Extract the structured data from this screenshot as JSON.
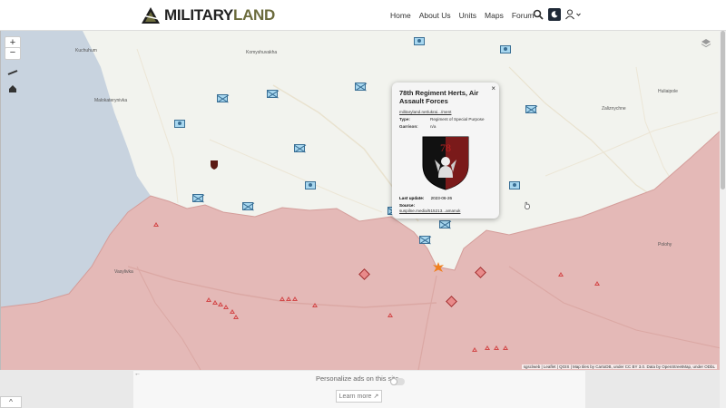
{
  "header": {
    "logo_part1": "MILITARY",
    "logo_part2": "LAND",
    "nav": [
      "Home",
      "About Us",
      "Units",
      "Maps",
      "Forum"
    ]
  },
  "map": {
    "places": [
      {
        "label": "Kuchuhum",
        "key": "kuchuhum"
      },
      {
        "label": "Komyshuvakha",
        "key": "komyshuvakha"
      },
      {
        "label": "Malokaterynivka",
        "key": "malokaterynivka"
      },
      {
        "label": "Huliaipole",
        "key": "huliaipole"
      },
      {
        "label": "Zaliznychne",
        "key": "zaliznychne"
      },
      {
        "label": "Vasylivka",
        "key": "vasylivka"
      },
      {
        "label": "Polohy",
        "key": "polohy"
      }
    ],
    "attribution": "sgsclweb | Leaflet | QGIS | Map tiles by CartoDB, under CC BY 3.0. Data by OpenStreetMap, under ODbL"
  },
  "popup": {
    "title": "78th Regiment Herts, Air Assault Forces",
    "link": "militaryland.net/ukrai.../ment",
    "type_label": "Type:",
    "type_value": "Regiment of Special Purpose",
    "garrison_label": "Garrison:",
    "garrison_value": "n/a",
    "emblem_number": "78",
    "update_label": "Last update:",
    "update_value": "2023-06-26",
    "source_label": "Source:",
    "source_value": "suspilne.media/515213...amanuk"
  },
  "adbar": {
    "text": "Personalize ads on this site",
    "learn": "Learn more"
  },
  "colors": {
    "occupied": "#e4b9b7",
    "unit_fill": "#a8d7ef",
    "unit_stroke": "#3a6f95",
    "water": "#c8d3df"
  }
}
